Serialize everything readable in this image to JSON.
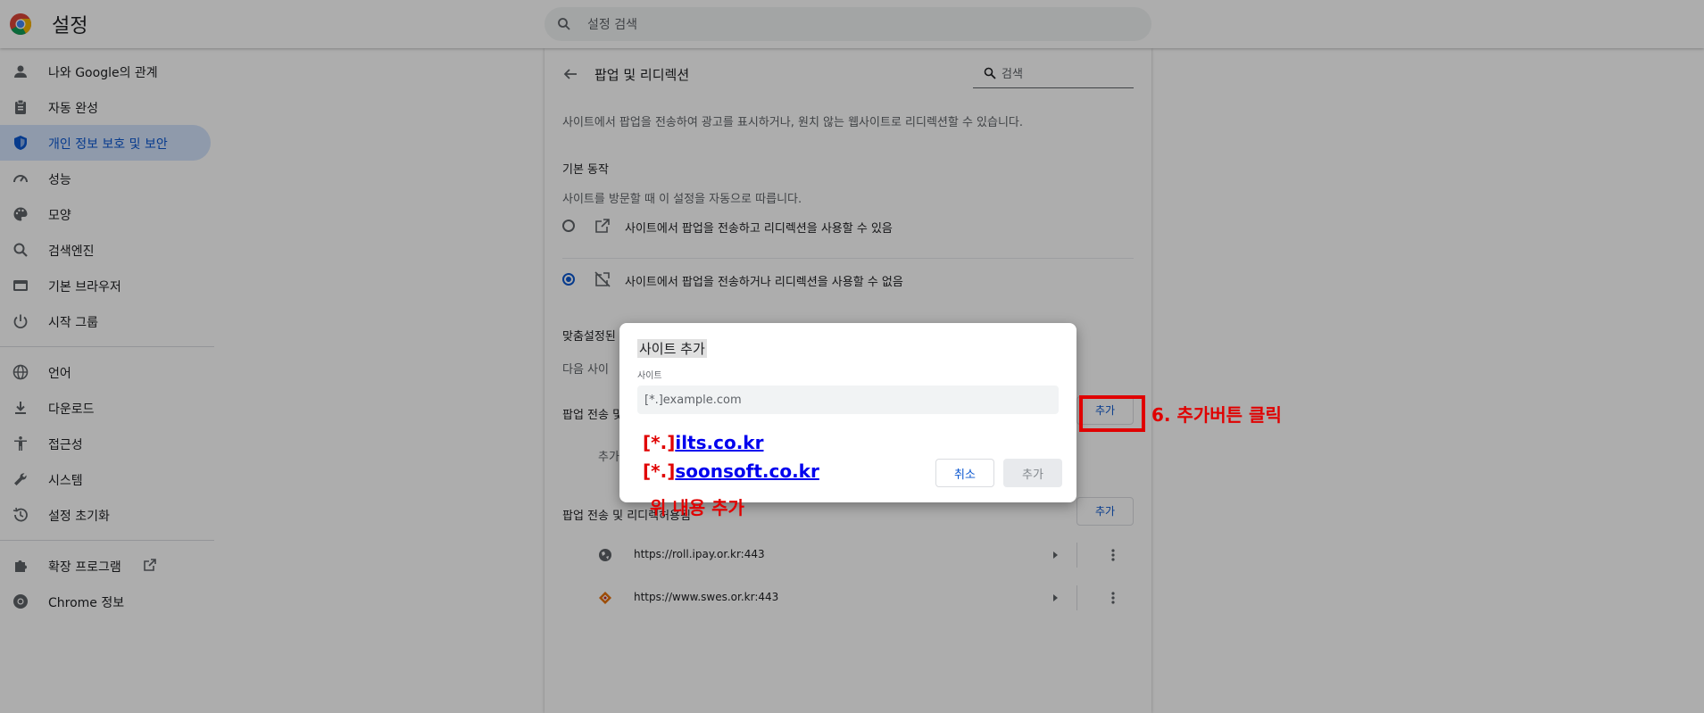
{
  "header": {
    "app_title": "설정",
    "search_placeholder": "설정 검색"
  },
  "sidebar": {
    "items": [
      {
        "label": "나와 Google의 관계",
        "icon": "person-icon"
      },
      {
        "label": "자동 완성",
        "icon": "clipboard-icon"
      },
      {
        "label": "개인 정보 보호 및 보안",
        "icon": "shield-icon",
        "active": true
      },
      {
        "label": "성능",
        "icon": "speedometer-icon"
      },
      {
        "label": "모양",
        "icon": "palette-icon"
      },
      {
        "label": "검색엔진",
        "icon": "search-icon"
      },
      {
        "label": "기본 브라우저",
        "icon": "browser-icon"
      },
      {
        "label": "시작 그룹",
        "icon": "power-icon"
      },
      {
        "label": "언어",
        "icon": "globe-icon"
      },
      {
        "label": "다운로드",
        "icon": "download-icon"
      },
      {
        "label": "접근성",
        "icon": "accessibility-icon"
      },
      {
        "label": "시스템",
        "icon": "wrench-icon"
      },
      {
        "label": "설정 초기화",
        "icon": "history-icon"
      },
      {
        "label": "확장 프로그램",
        "icon": "puzzle-icon"
      },
      {
        "label": "Chrome 정보",
        "icon": "chrome-icon"
      }
    ]
  },
  "main": {
    "title": "팝업 및 리디렉션",
    "search_placeholder": "검색",
    "description": "사이트에서 팝업을 전송하여 광고를 표시하거나, 원치 않는 웹사이트로 리디렉션할 수 있습니다.",
    "default_behavior_heading": "기본 동작",
    "default_behavior_sub": "사이트를 방문할 때 이 설정을 자동으로 따릅니다.",
    "option_allow": "사이트에서 팝업을 전송하고 리디렉션을 사용할 수 있음",
    "option_block": "사이트에서 팝업을 전송하거나 리디렉션을 사용할 수 없음",
    "custom_heading": "맞춤설정된",
    "custom_sub": "다음 사이",
    "block_section_label": "팝업 전송 및",
    "block_empty": "추가",
    "block_add": "추가",
    "allow_section_label": "팝업 전송 및 리디렉",
    "allow_section_label_tail": "허용됨",
    "allow_add": "추가",
    "sites": [
      {
        "url": "https://roll.ipay.or.kr:443",
        "icon": "globe-icon"
      },
      {
        "url": "https://www.swes.or.kr:443",
        "icon": "diamond-logo-icon"
      }
    ]
  },
  "dialog": {
    "title": "사이트 추가",
    "field_label": "사이트",
    "placeholder": "[*.]example.com",
    "cancel": "취소",
    "add": "추가"
  },
  "annotations": {
    "prefix": "[*.]",
    "domain1": "ilts.co.kr",
    "domain2": "soonsoft.co.kr",
    "note": "위 내용 추가",
    "step": "6. 추가버튼 클릭"
  },
  "colors": {
    "accent": "#0b57d0",
    "annotation": "#e00000",
    "active_nav_bg": "#d3e3fd"
  }
}
